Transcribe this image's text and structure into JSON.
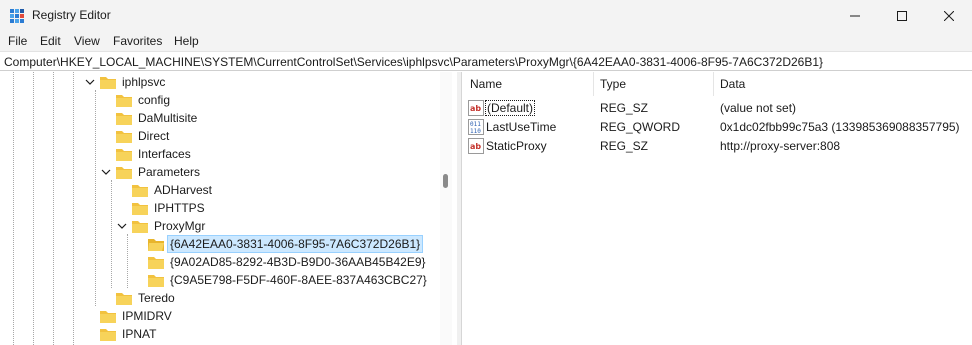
{
  "window": {
    "title": "Registry Editor"
  },
  "menu": [
    "File",
    "Edit",
    "View",
    "Favorites",
    "Help"
  ],
  "address": "Computer\\HKEY_LOCAL_MACHINE\\SYSTEM\\CurrentControlSet\\Services\\iphlpsvc\\Parameters\\ProxyMgr\\{6A42EAA0-3831-4006-8F95-7A6C372D26B1}",
  "tree": {
    "items": [
      {
        "label": "iphlpsvc",
        "expanded": true
      },
      {
        "label": "config"
      },
      {
        "label": "DaMultisite"
      },
      {
        "label": "Direct"
      },
      {
        "label": "Interfaces"
      },
      {
        "label": "Parameters",
        "expanded": true
      },
      {
        "label": "ADHarvest"
      },
      {
        "label": "IPHTTPS"
      },
      {
        "label": "ProxyMgr",
        "expanded": true
      },
      {
        "label": "{6A42EAA0-3831-4006-8F95-7A6C372D26B1}",
        "selected": true
      },
      {
        "label": "{9A02AD85-8292-4B3D-B9D0-36AAB45B42E9}"
      },
      {
        "label": "{C9A5E798-F5DF-460F-8AEE-837A463CBC27}"
      },
      {
        "label": "Teredo"
      },
      {
        "label": "IPMIDRV"
      },
      {
        "label": "IPNAT"
      }
    ]
  },
  "values": {
    "headers": {
      "name": "Name",
      "type": "Type",
      "data": "Data"
    },
    "rows": [
      {
        "name": "(Default)",
        "type": "REG_SZ",
        "data": "(value not set)",
        "icon": "string-value-icon"
      },
      {
        "name": "LastUseTime",
        "type": "REG_QWORD",
        "data": "0x1dc02fbb99c75a3 (133985369088357795)",
        "icon": "binary-value-icon"
      },
      {
        "name": "StaticProxy",
        "type": "REG_SZ",
        "data": "http://proxy-server:808",
        "icon": "string-value-icon"
      }
    ]
  },
  "colors": {
    "folder": "#f2c23f",
    "selection": "#cce8ff",
    "string_icon": "#c4332d",
    "binary_icon": "#2b5fb0"
  }
}
